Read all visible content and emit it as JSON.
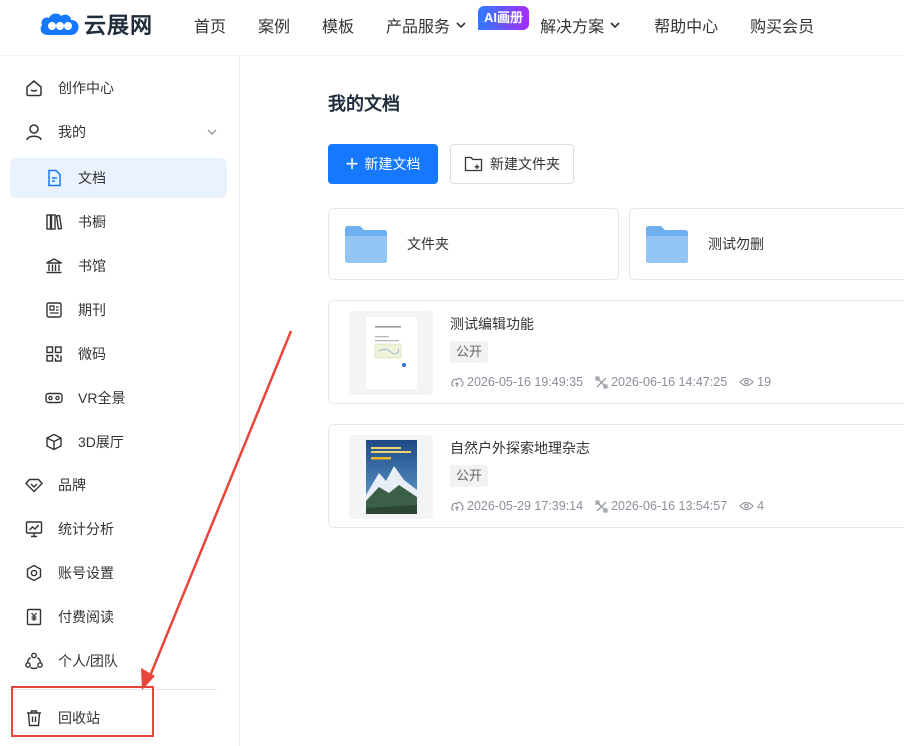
{
  "header": {
    "logo_text": "云展网",
    "nav": [
      {
        "label": "首页"
      },
      {
        "label": "案例"
      },
      {
        "label": "模板"
      },
      {
        "label": "产品服务",
        "has_dropdown": true
      },
      {
        "label": "解决方案",
        "has_dropdown": true
      },
      {
        "label": "帮助中心"
      },
      {
        "label": "购买会员"
      }
    ],
    "ai_badge": "AI画册"
  },
  "sidebar": {
    "items": [
      {
        "label": "创作中心",
        "icon": "home-icon"
      },
      {
        "label": "我的",
        "icon": "user-icon",
        "expanded": true
      },
      {
        "label": "文档",
        "icon": "document-icon",
        "active": true
      },
      {
        "label": "书橱",
        "icon": "bookcase-icon"
      },
      {
        "label": "书馆",
        "icon": "library-icon"
      },
      {
        "label": "期刊",
        "icon": "journal-icon"
      },
      {
        "label": "微码",
        "icon": "qrcode-icon"
      },
      {
        "label": "VR全景",
        "icon": "vr-icon"
      },
      {
        "label": "3D展厅",
        "icon": "cube-icon"
      },
      {
        "label": "品牌",
        "icon": "diamond-icon"
      },
      {
        "label": "统计分析",
        "icon": "chart-icon"
      },
      {
        "label": "账号设置",
        "icon": "settings-icon"
      },
      {
        "label": "付费阅读",
        "icon": "yen-icon"
      },
      {
        "label": "个人/团队",
        "icon": "team-icon"
      },
      {
        "label": "回收站",
        "icon": "trash-icon"
      }
    ]
  },
  "main": {
    "title": "我的文档",
    "new_doc_label": "新建文档",
    "new_folder_label": "新建文件夹",
    "folders": [
      {
        "name": "文件夹"
      },
      {
        "name": "测试勿删"
      }
    ],
    "documents": [
      {
        "title": "测试编辑功能",
        "tag": "公开",
        "created": "2026-05-16 19:49:35",
        "updated": "2026-06-16 14:47:25",
        "views": "19"
      },
      {
        "title": "自然户外探索地理杂志",
        "tag": "公开",
        "created": "2026-05-29 17:39:14",
        "updated": "2026-06-16 13:54:57",
        "views": "4"
      }
    ]
  },
  "colors": {
    "primary": "#1677ff",
    "active_bg": "#eaf2fd",
    "annotation": "#e8453c",
    "folder": "#7fb8f0"
  }
}
